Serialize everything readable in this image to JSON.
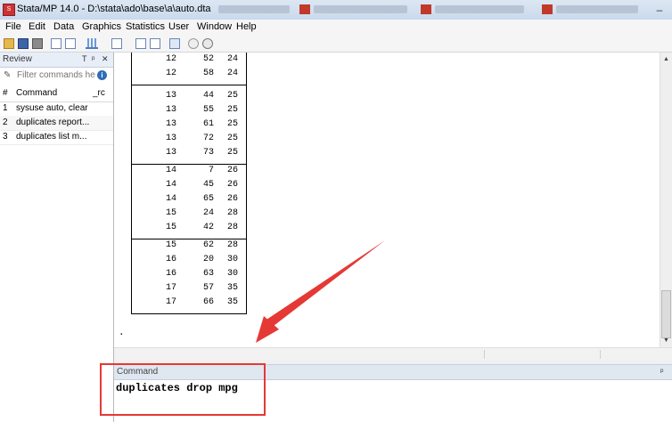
{
  "window": {
    "title": "Stata/MP 14.0 - D:\\stata\\ado\\base\\a\\auto.dta",
    "app_icon": "stata-icon",
    "minimize_glyph": "–"
  },
  "menu": [
    "File",
    "Edit",
    "Data",
    "Graphics",
    "Statistics",
    "User",
    "Window",
    "Help"
  ],
  "review": {
    "title": "Review",
    "controls": [
      "T",
      "ᵖ",
      "✕"
    ],
    "filter_placeholder": "Filter commands he",
    "columns": {
      "num": "#",
      "command": "Command",
      "rc": "_rc"
    },
    "items": [
      {
        "num": "1",
        "command": "sysuse auto, clear"
      },
      {
        "num": "2",
        "command": "duplicates report..."
      },
      {
        "num": "3",
        "command": "duplicates list  m..."
      }
    ]
  },
  "results": {
    "groups": [
      [
        [
          "12",
          "52",
          "24"
        ],
        [
          "12",
          "58",
          "24"
        ]
      ],
      [
        [
          "13",
          "44",
          "25"
        ],
        [
          "13",
          "55",
          "25"
        ],
        [
          "13",
          "61",
          "25"
        ],
        [
          "13",
          "72",
          "25"
        ],
        [
          "13",
          "73",
          "25"
        ]
      ],
      [
        [
          "14",
          "7",
          "26"
        ],
        [
          "14",
          "45",
          "26"
        ],
        [
          "14",
          "65",
          "26"
        ],
        [
          "15",
          "24",
          "28"
        ],
        [
          "15",
          "42",
          "28"
        ]
      ],
      [
        [
          "15",
          "62",
          "28"
        ],
        [
          "16",
          "20",
          "30"
        ],
        [
          "16",
          "63",
          "30"
        ],
        [
          "17",
          "57",
          "35"
        ],
        [
          "17",
          "66",
          "35"
        ]
      ]
    ],
    "prompt": "."
  },
  "command_panel": {
    "title": "Command",
    "input_value": "duplicates drop mpg",
    "pin_glyph": "ᵖ"
  },
  "colors": {
    "annotation_red": "#e53935"
  }
}
